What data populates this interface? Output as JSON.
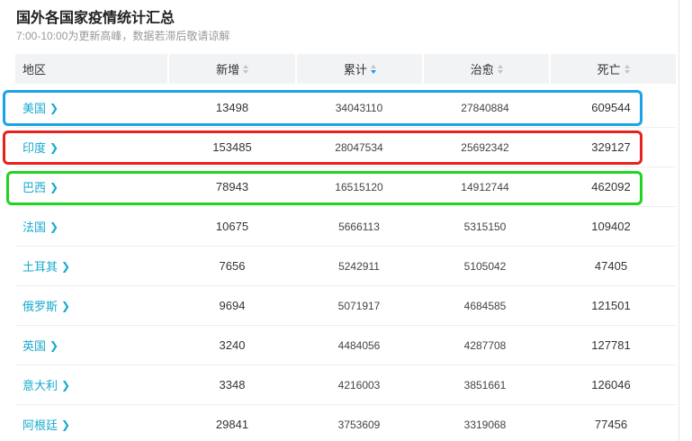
{
  "title": "国外各国家疫情统计汇总",
  "subtitle": "7:00-10:00为更新高峰，数据若滞后敬请谅解",
  "columns": [
    {
      "label": "地区",
      "sortable": false
    },
    {
      "label": "新增",
      "sortable": true,
      "active": false
    },
    {
      "label": "累计",
      "sortable": true,
      "active": true
    },
    {
      "label": "治愈",
      "sortable": true,
      "active": false
    },
    {
      "label": "死亡",
      "sortable": true,
      "active": false
    }
  ],
  "rows": [
    {
      "region": "美国",
      "new": "13498",
      "total": "34043110",
      "cured": "27840884",
      "deaths": "609544"
    },
    {
      "region": "印度",
      "new": "153485",
      "total": "28047534",
      "cured": "25692342",
      "deaths": "329127"
    },
    {
      "region": "巴西",
      "new": "78943",
      "total": "16515120",
      "cured": "14912744",
      "deaths": "462092"
    },
    {
      "region": "法国",
      "new": "10675",
      "total": "5666113",
      "cured": "5315150",
      "deaths": "109402"
    },
    {
      "region": "土耳其",
      "new": "7656",
      "total": "5242911",
      "cured": "5105042",
      "deaths": "47405"
    },
    {
      "region": "俄罗斯",
      "new": "9694",
      "total": "5071917",
      "cured": "4684585",
      "deaths": "121501"
    },
    {
      "region": "英国",
      "new": "3240",
      "total": "4484056",
      "cured": "4287708",
      "deaths": "127781"
    },
    {
      "region": "意大利",
      "new": "3348",
      "total": "4216003",
      "cured": "3851661",
      "deaths": "126046"
    },
    {
      "region": "阿根廷",
      "new": "29841",
      "total": "3753609",
      "cured": "3319068",
      "deaths": "77456"
    }
  ],
  "colors": {
    "accent": "#16a9cf",
    "sort_active": "#1c9cec",
    "highlight_blue": "#1aa3e8",
    "highlight_red": "#e8211f",
    "highlight_green": "#22d422"
  }
}
